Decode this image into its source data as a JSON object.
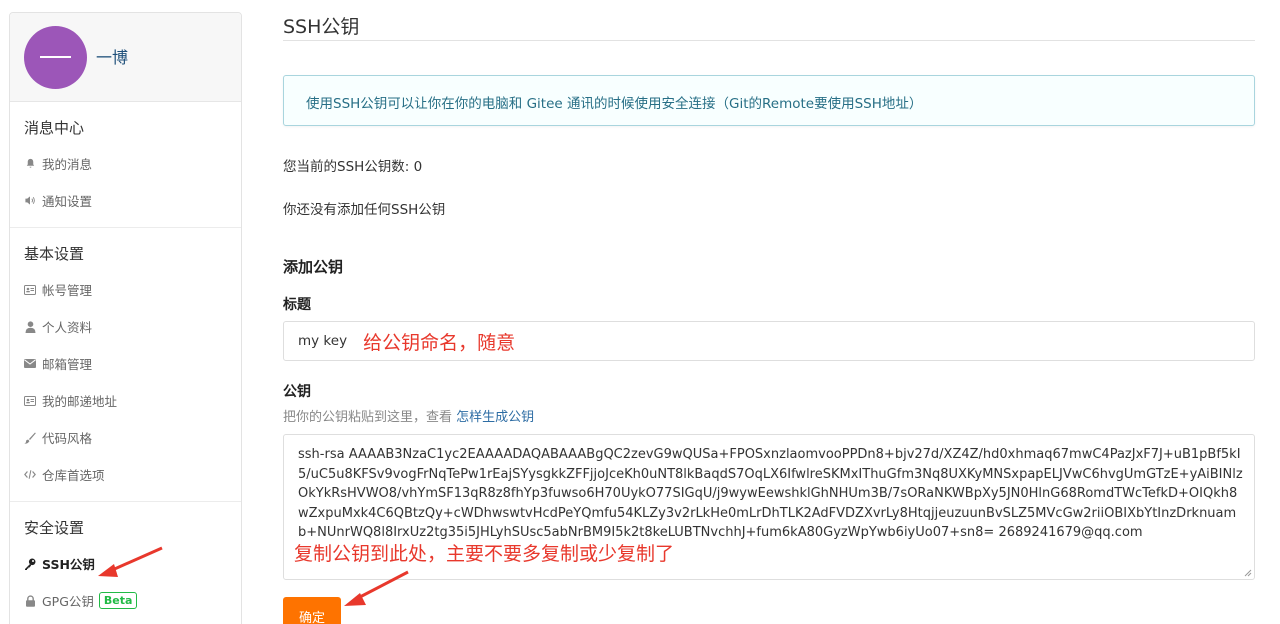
{
  "user": {
    "name": "一博"
  },
  "sidebar": {
    "sections": [
      {
        "title": "消息中心",
        "items": [
          {
            "label": "我的消息",
            "icon": "bell-icon"
          },
          {
            "label": "通知设置",
            "icon": "volume-icon"
          }
        ]
      },
      {
        "title": "基本设置",
        "items": [
          {
            "label": "帐号管理",
            "icon": "id-card-icon"
          },
          {
            "label": "个人资料",
            "icon": "user-icon"
          },
          {
            "label": "邮箱管理",
            "icon": "envelope-icon"
          },
          {
            "label": "我的邮递地址",
            "icon": "address-card-icon"
          },
          {
            "label": "代码风格",
            "icon": "paintbrush-icon"
          },
          {
            "label": "仓库首选项",
            "icon": "code-icon"
          }
        ]
      },
      {
        "title": "安全设置",
        "items": [
          {
            "label": "SSH公钥",
            "icon": "key-icon"
          },
          {
            "label": "GPG公钥",
            "icon": "lock-icon",
            "badge": "Beta"
          }
        ]
      }
    ]
  },
  "main": {
    "title": "SSH公钥",
    "info": "使用SSH公钥可以让你在你的电脑和 Gitee 通讯的时候使用安全连接（Git的Remote要使用SSH地址）",
    "count_text": "您当前的SSH公钥数: 0",
    "none_text": "你还没有添加任何SSH公钥",
    "add_title": "添加公钥",
    "title_label": "标题",
    "title_value": "my key",
    "title_annotation": "给公钥命名，随意",
    "key_label": "公钥",
    "key_hint": "把你的公钥粘贴到这里，查看",
    "key_hint_link": "怎样生成公钥",
    "key_value": "ssh-rsa AAAAB3NzaC1yc2EAAAADAQABAAABgQC2zevG9wQUSa+FPOSxnzlaomvooPPDn8+bjv27d/XZ4Z/hd0xhmaq67mwC4PazJxF7J+uB1pBf5kI5/uC5u8KFSv9vogFrNqTePw1rEajSYysgkkZFFjjoJceKh0uNT8lkBaqdS7OqLX6IfwlreSKMxIThuGfm3Nq8UXKyMNSxpapELJVwC6hvgUmGTzE+yAiBINlzOkYkRsHVWO8/vhYmSF13qR8z8fhYp3fuwso6H70UykO77SIGqU/j9wywEewshklGhNHUm3B/7sORaNKWBpXy5JN0HlnG68RomdTWcTefkD+OIQkh8wZxpuMxk4C6QBtzQy+cWDhwswtvHcdPeYQmfu54KLZy3v2rLkHe0mLrDhTLK2AdFVDZXvrLy8HtqjjeuzuunBvSLZ5MVcGw2riiOBIXbYtInzDrknuamb+NUnrWQ8l8IrxUz2tg35i5JHLyhSUsc5abNrBM9I5k2t8keLUBTNvchhJ+fum6kA80GyzWpYwb6iyUo07+sn8= 2689241679@qq.com",
    "key_annotation": "复制公钥到此处，主要不要多复制或少复制了",
    "confirm_label": "确定"
  },
  "colors": {
    "accent": "#fe7300",
    "annotation": "#e8382c",
    "info_text": "#276f86",
    "avatar": "#9c56b8"
  }
}
